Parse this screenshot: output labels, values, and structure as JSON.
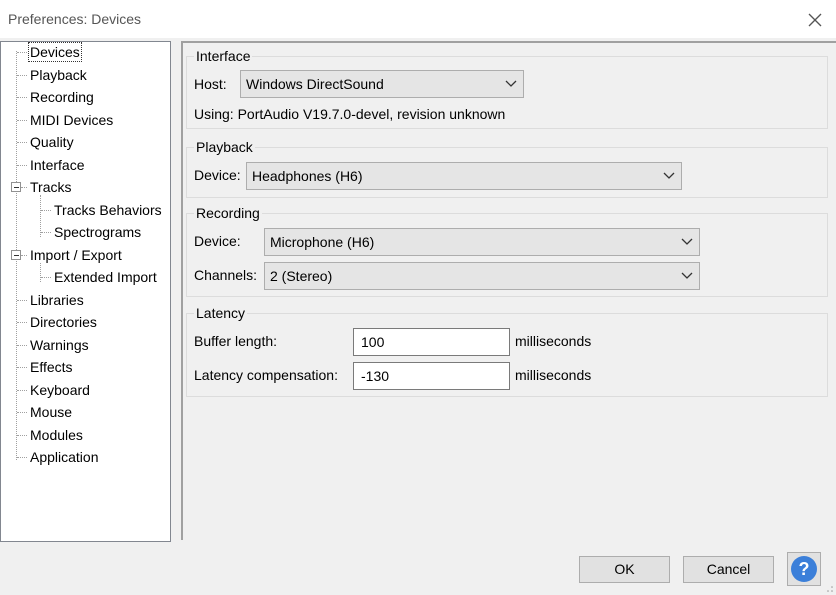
{
  "window": {
    "title": "Preferences: Devices"
  },
  "tree": {
    "items": [
      "Devices",
      "Playback",
      "Recording",
      "MIDI Devices",
      "Quality",
      "Interface",
      "Tracks",
      "Tracks Behaviors",
      "Spectrograms",
      "Import / Export",
      "Extended Import",
      "Libraries",
      "Directories",
      "Warnings",
      "Effects",
      "Keyboard",
      "Mouse",
      "Modules",
      "Application"
    ],
    "selected": "Devices"
  },
  "interface": {
    "title": "Interface",
    "host_label": "Host:",
    "host_value": "Windows DirectSound",
    "using_text": "Using: PortAudio V19.7.0-devel, revision unknown"
  },
  "playback": {
    "title": "Playback",
    "device_label": "Device:",
    "device_value": "Headphones (H6)"
  },
  "recording": {
    "title": "Recording",
    "device_label": "Device:",
    "device_value": "Microphone (H6)",
    "channels_label": "Channels:",
    "channels_value": "2 (Stereo)"
  },
  "latency": {
    "title": "Latency",
    "buffer_label": "Buffer length:",
    "buffer_value": "100",
    "buffer_unit": "milliseconds",
    "comp_label": "Latency compensation:",
    "comp_value": "-130",
    "comp_unit": "milliseconds"
  },
  "buttons": {
    "ok": "OK",
    "cancel": "Cancel",
    "help": "?"
  }
}
